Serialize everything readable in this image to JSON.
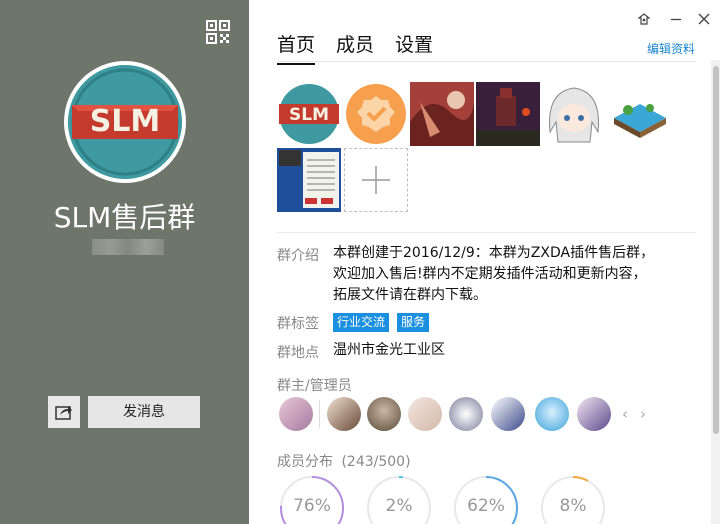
{
  "group": {
    "name": "SLM售后群",
    "avatar_text": "SLM"
  },
  "left_panel": {
    "send_message_label": "发消息",
    "share_icon": "share-icon",
    "qr_icon": "qr-code-icon"
  },
  "window": {
    "controls": [
      "skin-icon",
      "minimize-icon",
      "close-icon"
    ]
  },
  "tabs": [
    {
      "label": "首页",
      "active": true
    },
    {
      "label": "成员",
      "active": false
    },
    {
      "label": "设置",
      "active": false
    }
  ],
  "edit_link": "编辑资料",
  "photos": {
    "items": [
      {
        "name": "photo-slm-logo"
      },
      {
        "name": "photo-verified-badge"
      },
      {
        "name": "photo-anime-art-1"
      },
      {
        "name": "photo-game-scene"
      },
      {
        "name": "photo-anime-girl"
      },
      {
        "name": "photo-island"
      },
      {
        "name": "photo-document"
      }
    ],
    "add_icon": "plus-icon"
  },
  "info": {
    "intro_label": "群介绍",
    "intro_lines": [
      "本群创建于2016/12/9：本群为ZXDA插件售后群，",
      "欢迎加入售后!群内不定期发插件活动和更新内容，",
      "拓展文件请在群内下载。"
    ],
    "tags_label": "群标签",
    "tags": [
      "行业交流",
      "服务"
    ],
    "location_label": "群地点",
    "location": "温州市金光工业区"
  },
  "admins": {
    "label": "群主/管理员",
    "prev_icon": "chevron-left-icon",
    "next_icon": "chevron-right-icon"
  },
  "members": {
    "label": "成员分布",
    "count": "(243/500)",
    "stats": [
      {
        "value": "76%",
        "fraction": 0.76,
        "color": "#b48fe0"
      },
      {
        "value": "2%",
        "fraction": 0.02,
        "color": "#4fc3e8"
      },
      {
        "value": "62%",
        "fraction": 0.62,
        "color": "#5aa6e0"
      },
      {
        "value": "8%",
        "fraction": 0.08,
        "color": "#f4a83a"
      }
    ]
  },
  "colors": {
    "left_panel_bg": "#6e756b",
    "accent_blue": "#1b86d2",
    "tag_blue": "#1b8fe0"
  }
}
